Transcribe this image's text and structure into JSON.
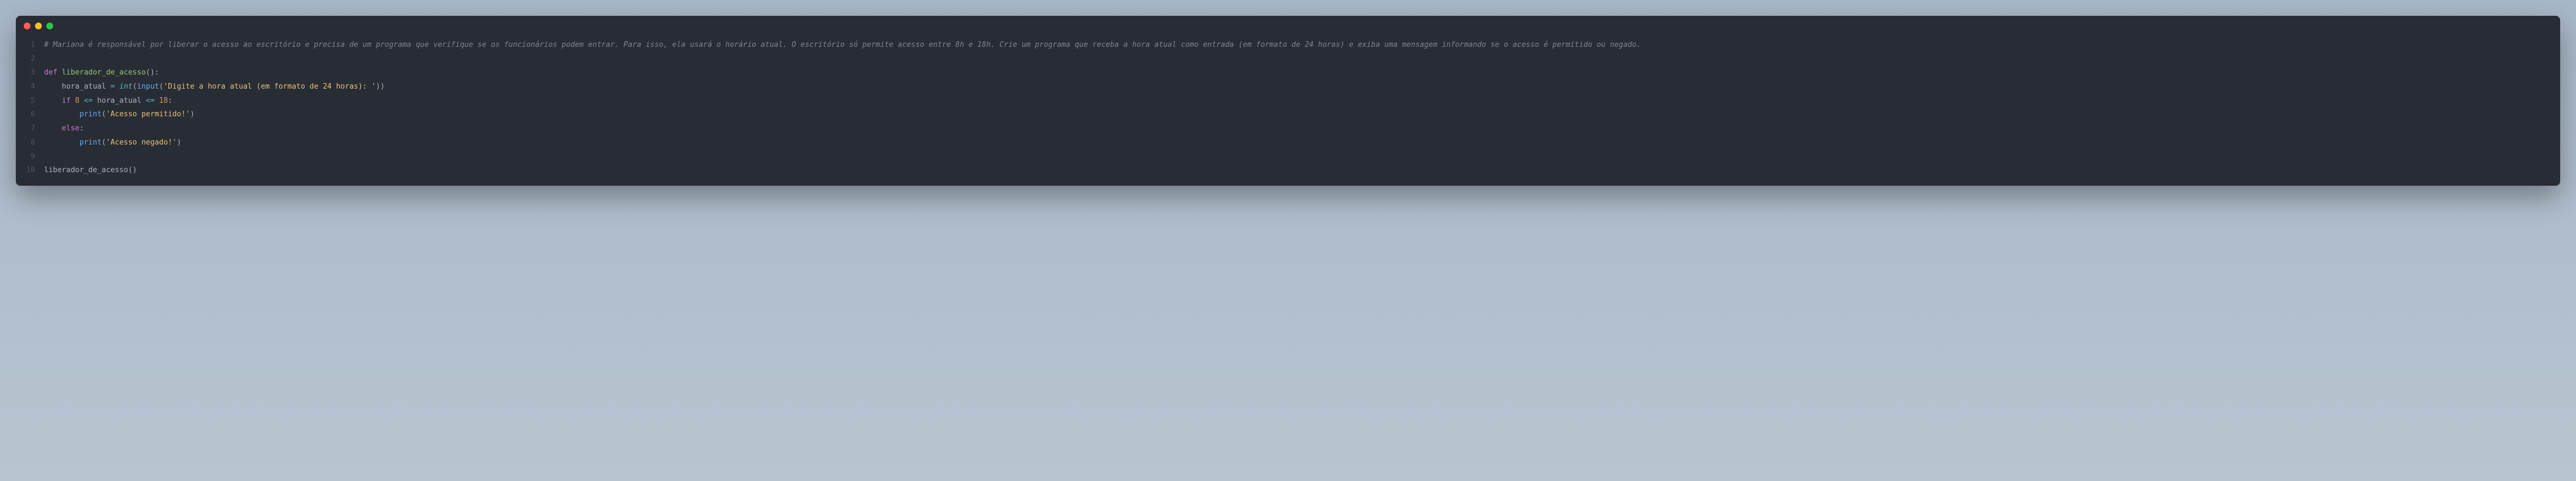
{
  "window": {
    "dots": [
      "red",
      "yellow",
      "green"
    ]
  },
  "code": {
    "lines": [
      {
        "n": "1",
        "tokens": [
          [
            "comment",
            "# Mariana é responsável por liberar o acesso ao escritório e precisa de um programa que verifique se os funcionários podem entrar. Para isso, ela usará o horário atual. O escritório só permite acesso entre 8h e 18h. Crie um programa que receba a hora atual como entrada (em formato de 24 horas) e exiba uma mensagem informando se o acesso é permitido ou negado."
          ]
        ]
      },
      {
        "n": "2",
        "tokens": []
      },
      {
        "n": "3",
        "tokens": [
          [
            "keyword",
            "def "
          ],
          [
            "funcname",
            "liberador_de_acesso"
          ],
          [
            "punct",
            "():"
          ]
        ]
      },
      {
        "n": "4",
        "tokens": [
          [
            "plain",
            "    "
          ],
          [
            "plain",
            "hora_atual "
          ],
          [
            "op",
            "="
          ],
          [
            "plain",
            " "
          ],
          [
            "builtin",
            "int"
          ],
          [
            "punct",
            "("
          ],
          [
            "def",
            "input"
          ],
          [
            "punct",
            "("
          ],
          [
            "string",
            "'Digite a hora atual (em formato de 24 horas): '"
          ],
          [
            "punct",
            "))"
          ]
        ]
      },
      {
        "n": "5",
        "tokens": [
          [
            "plain",
            "    "
          ],
          [
            "keyword",
            "if"
          ],
          [
            "plain",
            " "
          ],
          [
            "number",
            "8"
          ],
          [
            "plain",
            " "
          ],
          [
            "op",
            "<="
          ],
          [
            "plain",
            " hora_atual "
          ],
          [
            "op",
            "<="
          ],
          [
            "plain",
            " "
          ],
          [
            "number",
            "18"
          ],
          [
            "punct",
            ":"
          ]
        ]
      },
      {
        "n": "6",
        "tokens": [
          [
            "plain",
            "        "
          ],
          [
            "def",
            "print"
          ],
          [
            "punct",
            "("
          ],
          [
            "string",
            "'Acesso permitido!'"
          ],
          [
            "punct",
            ")"
          ]
        ]
      },
      {
        "n": "7",
        "tokens": [
          [
            "plain",
            "    "
          ],
          [
            "keyword",
            "else"
          ],
          [
            "punct",
            ":"
          ]
        ]
      },
      {
        "n": "8",
        "tokens": [
          [
            "plain",
            "        "
          ],
          [
            "def",
            "print"
          ],
          [
            "punct",
            "("
          ],
          [
            "string",
            "'Acesso negado!'"
          ],
          [
            "punct",
            ")"
          ]
        ]
      },
      {
        "n": "9",
        "tokens": []
      },
      {
        "n": "10",
        "tokens": [
          [
            "plain",
            "liberador_de_acesso()"
          ]
        ]
      }
    ]
  }
}
